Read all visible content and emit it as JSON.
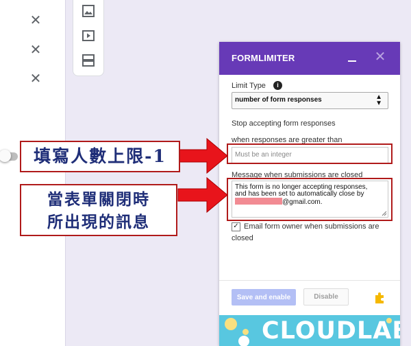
{
  "form_bg": {
    "close_icons": [
      "close-icon",
      "close-icon",
      "close-icon"
    ],
    "floating_toolbar": [
      "image-icon",
      "video-icon",
      "section-icon"
    ]
  },
  "panel": {
    "title": "FORMLIMITER",
    "limit_type_label": "Limit Type",
    "limit_type_value": "number of form responses",
    "stop_label": "Stop accepting form responses",
    "when_label": "when responses are greater than",
    "when_placeholder": "Must be an integer",
    "message_label": "Message when submissions are closed",
    "message_line1": "This form is no longer accepting responses,",
    "message_line2": "and has been set to automatically close by",
    "message_email_suffix": "@gmail.com.",
    "email_owner_label_line1": "Email form owner when submissions are",
    "email_owner_label_line2": "closed",
    "email_owner_checked": true,
    "save_button": "Save and enable",
    "disable_button": "Disable",
    "banner_text": "CLOUDLAB"
  },
  "annotations": {
    "label1": "填寫人數上限-1",
    "label2_line1": "當表單關閉時",
    "label2_line2": "所出現的訊息"
  },
  "colors": {
    "header": "#673ab7",
    "annotation_border": "#b01a1a",
    "arrow": "#e8141b",
    "annotation_text": "#1f2e78",
    "banner": "#58c7e0"
  }
}
